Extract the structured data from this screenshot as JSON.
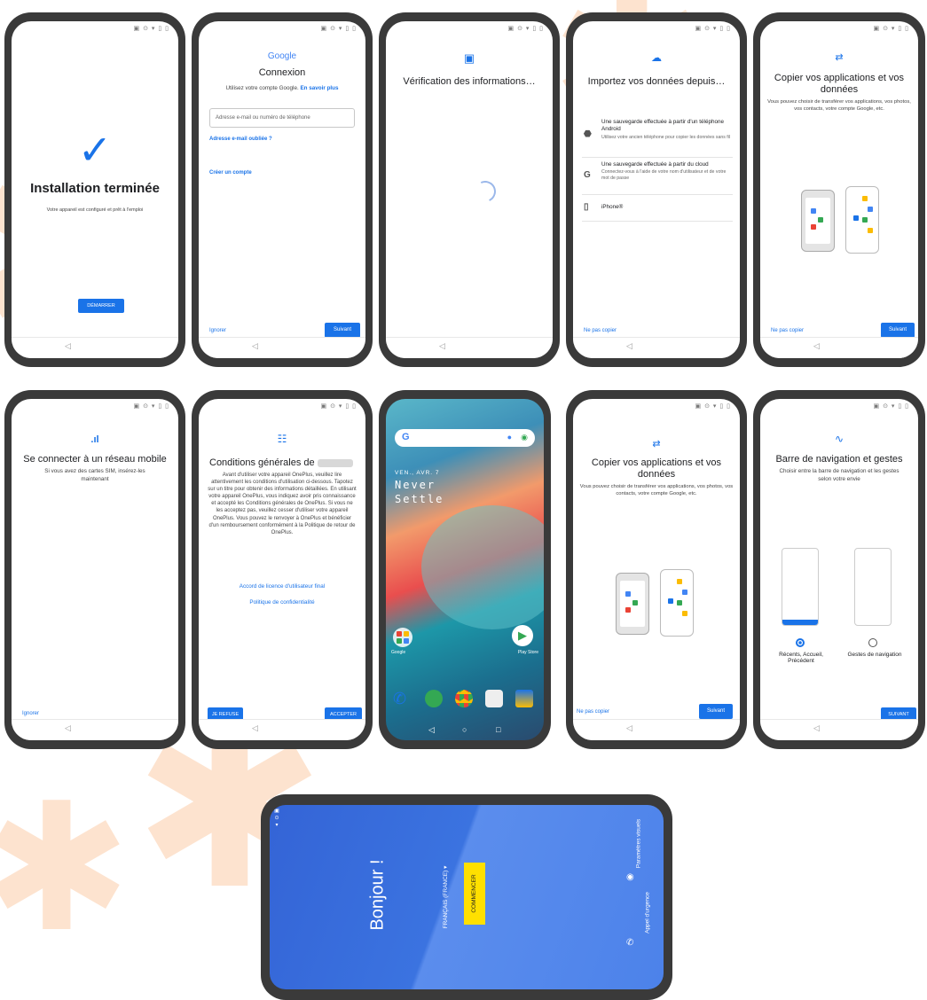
{
  "status_bar": "▣ ⊙ ▾ ▯ ▯",
  "nav_back": "◁",
  "screen1": {
    "check": "✓",
    "title": "Installation terminée",
    "subtitle": "Votre appareil est configuré et prêt à l'emploi",
    "button": "DÉMARRER"
  },
  "screen2": {
    "logo": "Google",
    "title": "Connexion",
    "subtitle": "Utilisez votre compte Google.",
    "learn_more": "En savoir plus",
    "input_placeholder": "Adresse e-mail ou numéro de téléphone",
    "forgot": "Adresse e-mail oubliée ?",
    "create": "Créer un compte",
    "skip": "Ignorer",
    "next": "Suivant"
  },
  "screen3": {
    "title": "Vérification des informations…"
  },
  "screen4": {
    "title": "Importez vos données depuis…",
    "options": [
      {
        "icon": "android-icon",
        "glyph": "⬣",
        "title": "Une sauvegarde effectuée à partir d'un téléphone Android",
        "sub": "Utilisez votre ancien téléphone pour copier les données sans fil"
      },
      {
        "icon": "google-icon",
        "glyph": "G",
        "title": "Une sauvegarde effectuée à partir du cloud",
        "sub": "Connectez-vous à l'aide de votre nom d'utilisateur et de votre mot de passe"
      },
      {
        "icon": "iphone-icon",
        "glyph": "▯",
        "title": "iPhone®",
        "sub": ""
      }
    ],
    "no_copy": "Ne pas copier"
  },
  "copy_screen": {
    "title": "Copier vos applications et vos données",
    "subtitle": "Vous pouvez choisir de transférer vos applications, vos photos, vos contacts, votre compte Google, etc.",
    "no_copy": "Ne pas copier",
    "next": "Suivant"
  },
  "screen6": {
    "title": "Se connecter à un réseau mobile",
    "subtitle": "Si vous avez des cartes SIM, insérez-les maintenant",
    "skip": "Ignorer"
  },
  "screen7": {
    "title": "Conditions générales de",
    "body": "Avant d'utiliser votre appareil OnePlus, veuillez lire attentivement les conditions d'utilisation ci-dessous. Tapotez sur un titre pour obtenir des informations détaillées. En utilisant votre appareil OnePlus, vous indiquez avoir pris connaissance et accepté les Conditions générales de OnePlus. Si vous ne les acceptez pas, veuillez cesser d'utiliser votre appareil OnePlus. Vous pouvez le renvoyer à OnePlus et bénéficier d'un remboursement conformément à la Politique de retour de OnePlus.",
    "link1": "Accord de licence d'utilisateur final",
    "link2": "Politique de confidentialité",
    "refuse": "JE REFUSE",
    "accept": "ACCEPTER"
  },
  "screen8": {
    "date": "VEN., AVR. 7",
    "slogan1": "Never",
    "slogan2": "Settle",
    "folder_label": "Google",
    "play_label": "Play Store"
  },
  "screen10": {
    "title": "Barre de navigation et gestes",
    "subtitle": "Choisir entre la barre de navigation et les gestes selon votre envie",
    "option1": "Récents, Accueil, Précédent",
    "option2": "Gestes de navigation",
    "button": "SUIVANT"
  },
  "screen11": {
    "greeting": "Bonjour !",
    "language": "FRANÇAIS (FRANCE) ▾",
    "start": "COMMENCER",
    "visual": "Paramètres visuels",
    "emergency": "Appel d'urgence"
  },
  "colors": {
    "accent": "#1a73e8",
    "hello_bg": "#3b73e0",
    "start_btn": "#ffe000"
  }
}
